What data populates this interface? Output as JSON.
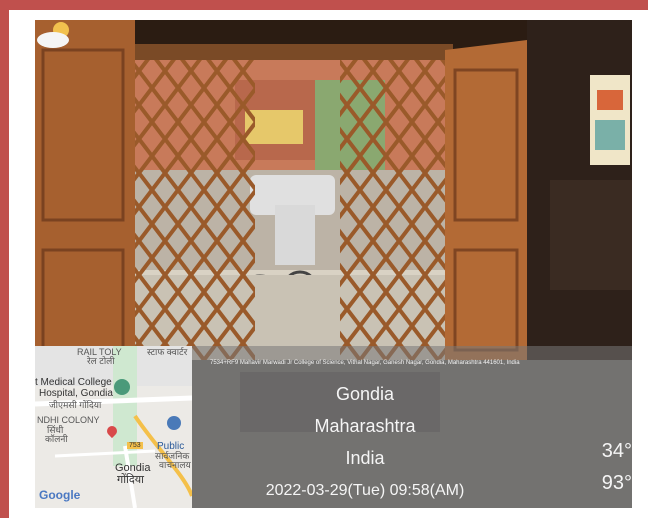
{
  "location": {
    "address": "7534+RF9 Mahavir Marwadi Jr College of Science, Vithal Nagar, Ganesh Nagar, Gondia, Maharashtra 441601, India",
    "city": "Gondia",
    "state": "Maharashtra",
    "country": "India"
  },
  "datetime": "2022-03-29(Tue)   09:58(AM)",
  "weather": {
    "temperature": "34°",
    "humidity": "93°",
    "icon": "partly-cloudy-icon"
  },
  "map": {
    "labels": {
      "rail_toly": "RAIL TOLY",
      "rail_toly_local": "रेल टोली",
      "hospital_line1": "t Medical College",
      "hospital_line2": "Hospital, Gondia",
      "hospital_local": "जीएमसी गोंदिया",
      "ndhi_colony": "NDHI COLONY",
      "ndhi_local1": "सिंधी",
      "ndhi_local2": "कॉलनी",
      "public": "Public",
      "public_local1": "सार्वजनिक",
      "public_local2": "वाचनालय",
      "gondia": "Gondia",
      "gondia_local": "गोंदिया",
      "road_shield": "753",
      "top_text": "स्टाफ क्वार्टर"
    },
    "attribution": "Google"
  },
  "colors": {
    "frame": "#c0504d",
    "overlay": "rgba(120,120,120,0.55)"
  }
}
